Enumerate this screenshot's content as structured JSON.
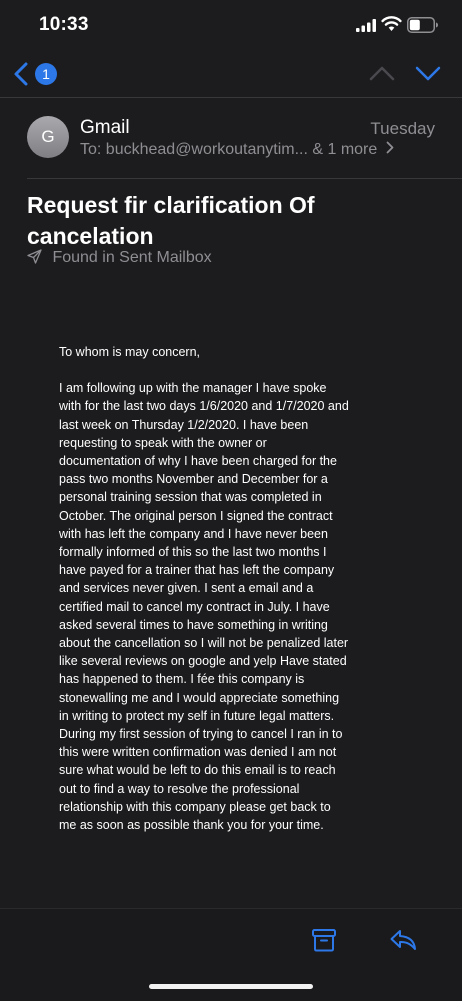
{
  "status_bar": {
    "time": "10:33"
  },
  "nav": {
    "back_badge_count": "1"
  },
  "message": {
    "sender": "Gmail",
    "avatar_initial": "G",
    "date": "Tuesday",
    "to_label": "To:",
    "to_value": "buckhead@workoutanytim... & 1 more",
    "subject": "Request fir clarification Of cancelation",
    "mailbox_note": "Found in Sent Mailbox",
    "greeting": "To whom is may concern,",
    "body": "I am following up with the manager I have spoke with for the last two days 1/6/2020 and 1/7/2020 and last week on Thursday 1/2/2020. I have been requesting to speak with the owner or documentation of why I have been charged for the pass two months November and December for a personal training session that was completed in October. The original person I signed the contract with has left the company and I have never been formally informed of this so the last two months I have payed for a trainer that has left the company and services never given. I sent a email and a certified mail to cancel my contract in July. I have asked several times to have something in writing about the cancellation so I will not be penalized later like several reviews on google and yelp Have stated has happened to them.  I fée this company is stonewalling me and I would appreciate something in writing to protect my self in future legal matters. During my first session of trying to cancel I ran in to this were written confirmation was denied I am not sure what would be left to do this email is to reach out to find a way to resolve the professional relationship with this company please get back to me as soon as possible thank you for your time."
  },
  "icons": {
    "back": "chevron-left-icon",
    "prev": "chevron-up-icon",
    "next": "chevron-down-icon",
    "sent": "paper-plane-icon",
    "archive": "archive-box-icon",
    "reply": "reply-arrow-icon"
  },
  "colors": {
    "background": "#1c1c1e",
    "accent": "#2d78e8",
    "secondary_text": "#8e8e93"
  }
}
